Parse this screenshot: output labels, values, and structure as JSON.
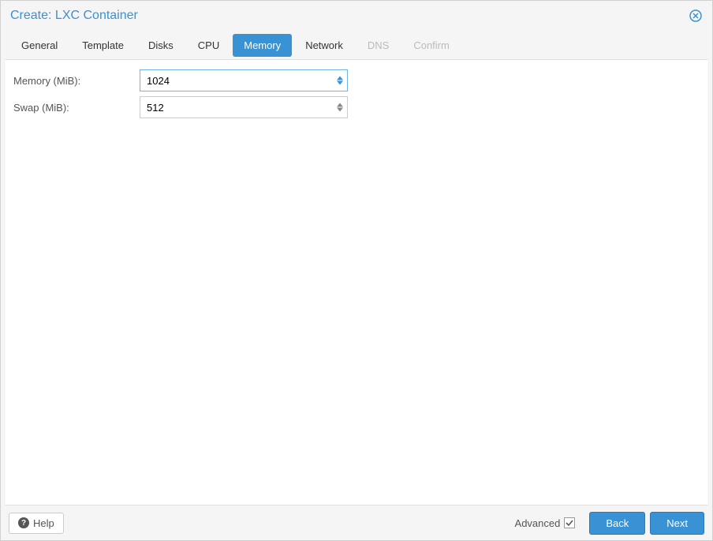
{
  "dialog": {
    "title": "Create: LXC Container"
  },
  "tabs": {
    "general": "General",
    "template": "Template",
    "disks": "Disks",
    "cpu": "CPU",
    "memory": "Memory",
    "network": "Network",
    "dns": "DNS",
    "confirm": "Confirm",
    "active": "memory"
  },
  "form": {
    "memory_label": "Memory (MiB):",
    "memory_value": "1024",
    "swap_label": "Swap (MiB):",
    "swap_value": "512"
  },
  "footer": {
    "help_label": "Help",
    "advanced_label": "Advanced",
    "advanced_checked": true,
    "back_label": "Back",
    "next_label": "Next"
  }
}
